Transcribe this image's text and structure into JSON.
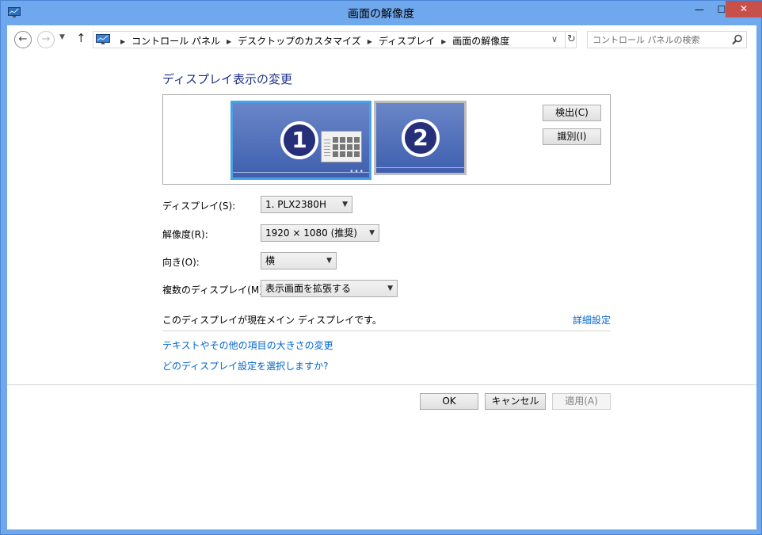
{
  "window": {
    "title": "画面の解像度",
    "min_label": "—",
    "max_label": "☐",
    "close_label": "✕"
  },
  "nav": {
    "back_label": "←",
    "forward_label": "→",
    "recent_label": "▼",
    "up_label": "↑",
    "breadcrumbs": [
      "コントロール パネル",
      "デスクトップのカスタマイズ",
      "ディスプレイ",
      "画面の解像度"
    ],
    "breadcrumb_sep": "▶",
    "address_dropdown": "∨",
    "refresh_label": "↻",
    "search_placeholder": "コントロール パネルの検索"
  },
  "main": {
    "heading": "ディスプレイ表示の変更",
    "monitors": [
      {
        "number": "1",
        "selected": true
      },
      {
        "number": "2",
        "selected": false
      }
    ],
    "monitor_dots": "•••",
    "detect_button": "検出(C)",
    "identify_button": "識別(I)",
    "settings": {
      "display_label": "ディスプレイ(S):",
      "display_value": "1. PLX2380H",
      "resolution_label": "解像度(R):",
      "resolution_value": "1920 × 1080 (推奨)",
      "orientation_label": "向き(O):",
      "orientation_value": "横",
      "multi_label": "複数のディスプレイ(M):",
      "multi_value": "表示画面を拡張する"
    },
    "select_caret": "▼",
    "main_display_status": "このディスプレイが現在メイン ディスプレイです。",
    "advanced_link": "詳細設定",
    "text_size_link": "テキストやその他の項目の大きさの変更",
    "which_settings_link": "どのディスプレイ設定を選択しますか?"
  },
  "buttons": {
    "ok": "OK",
    "cancel": "キャンセル",
    "apply": "適用(A)"
  },
  "colors": {
    "frame": "#6fa8ec",
    "heading": "#1e3287",
    "link": "#0066cc",
    "monitor_fill": "#4f6db9",
    "selected_border": "#47a3e5",
    "close_button": "#c7504b"
  }
}
